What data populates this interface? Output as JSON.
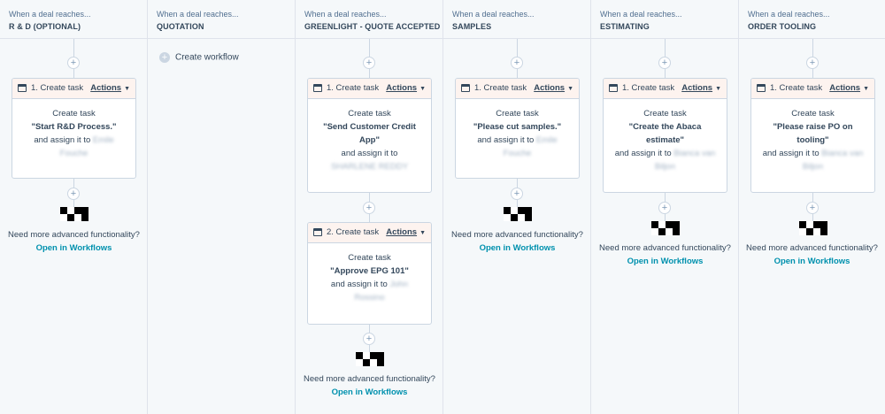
{
  "columns": [
    {
      "trigger": "When a deal reaches...",
      "stage": "R & D (OPTIONAL)"
    },
    {
      "trigger": "When a deal reaches...",
      "stage": "QUOTATION"
    },
    {
      "trigger": "When a deal reaches...",
      "stage": "GREENLIGHT - QUOTE ACCEPTED"
    },
    {
      "trigger": "When a deal reaches...",
      "stage": "SAMPLES"
    },
    {
      "trigger": "When a deal reaches...",
      "stage": "ESTIMATING"
    },
    {
      "trigger": "When a deal reaches...",
      "stage": "ORDER TOOLING"
    }
  ],
  "plus_symbol": "+",
  "create_workflow": "Create workflow",
  "actions_label": "Actions",
  "caret": "▼",
  "cards": [
    {
      "label": "1. Create task",
      "line1": "Create task",
      "line2": "\"Start R&D Process.\"",
      "line3": "and assign it to Emile",
      "line4": "Fouche"
    },
    {
      "label": "1. Create task",
      "line1": "Create task",
      "line2": "\"Send Customer Credit",
      "line3": "App\"",
      "line4": "and assign it to",
      "line5": "SHARLENE REDDY"
    },
    {
      "label": "2. Create task",
      "line1": "Create task",
      "line2": "\"Approve EPG 101\"",
      "line3": "and assign it to John",
      "line4": "Rossino"
    },
    {
      "label": "1. Create task",
      "line1": "Create task",
      "line2": "\"Please cut samples.\"",
      "line3": "and assign it to Emile",
      "line4": "Fouche"
    },
    {
      "label": "1. Create task",
      "line1": "Create task",
      "line2": "\"Create the Abaca",
      "line3": "estimate\"",
      "line4": "and assign it to Bianca van",
      "line5": "Biljon"
    },
    {
      "label": "1. Create task",
      "line1": "Create task",
      "line2": "\"Please raise PO on",
      "line3": "tooling\"",
      "line4": "and assign it to Bianca van",
      "line5": "Biljon"
    }
  ],
  "need_more": "Need more advanced functionality?",
  "open_workflows": "Open in Workflows"
}
